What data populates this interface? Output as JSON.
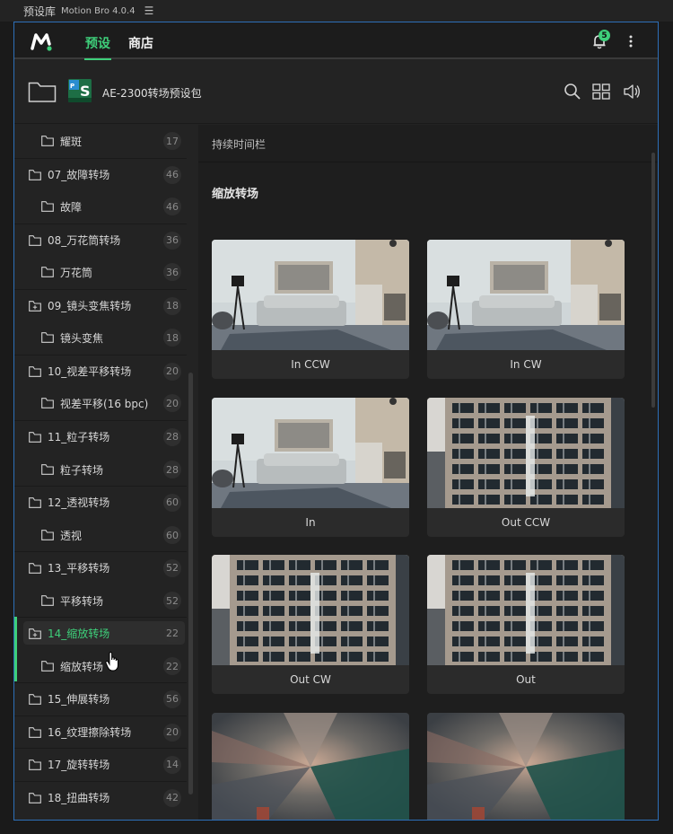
{
  "window": {
    "title": "预设库",
    "app_version": "Motion Bro 4.0.4",
    "menu_icon": "hamburger-icon"
  },
  "topnav": {
    "tabs": [
      {
        "label": "预设",
        "active": true
      },
      {
        "label": "商店",
        "active": false
      }
    ],
    "notification_count": "5",
    "accent_color": "#3ecf7a"
  },
  "pack": {
    "title": "AE-2300转场预设包",
    "icons": [
      "folder-icon",
      "search-icon",
      "grid-view-icon",
      "volume-icon"
    ]
  },
  "sidebar": {
    "items": [
      {
        "label": "耀斑",
        "count": "17",
        "level": "child",
        "icon": "folder-icon"
      },
      {
        "label": "07_故障转场",
        "count": "46",
        "level": "parent",
        "icon": "folder-icon"
      },
      {
        "label": "故障",
        "count": "46",
        "level": "child",
        "icon": "folder-icon"
      },
      {
        "label": "08_万花筒转场",
        "count": "36",
        "level": "parent",
        "icon": "folder-icon"
      },
      {
        "label": "万花筒",
        "count": "36",
        "level": "child",
        "icon": "folder-icon"
      },
      {
        "label": "09_镜头变焦转场",
        "count": "18",
        "level": "parent",
        "icon": "zoom-folder-icon"
      },
      {
        "label": "镜头变焦",
        "count": "18",
        "level": "child",
        "icon": "folder-icon"
      },
      {
        "label": "10_视差平移转场",
        "count": "20",
        "level": "parent",
        "icon": "folder-icon"
      },
      {
        "label": "视差平移(16 bpc)",
        "count": "20",
        "level": "child",
        "icon": "folder-icon"
      },
      {
        "label": "11_粒子转场",
        "count": "28",
        "level": "parent",
        "icon": "folder-icon"
      },
      {
        "label": "粒子转场",
        "count": "28",
        "level": "child",
        "icon": "folder-icon"
      },
      {
        "label": "12_透视转场",
        "count": "60",
        "level": "parent",
        "icon": "folder-icon"
      },
      {
        "label": "透视",
        "count": "60",
        "level": "child",
        "icon": "folder-icon"
      },
      {
        "label": "13_平移转场",
        "count": "52",
        "level": "parent",
        "icon": "folder-icon"
      },
      {
        "label": "平移转场",
        "count": "52",
        "level": "child",
        "icon": "folder-icon"
      },
      {
        "label": "14_缩放转场",
        "count": "22",
        "level": "parent",
        "icon": "zoom-folder-icon",
        "selected": true
      },
      {
        "label": "缩放转场",
        "count": "22",
        "level": "child",
        "icon": "folder-icon"
      },
      {
        "label": "15_伸展转场",
        "count": "56",
        "level": "parent",
        "icon": "folder-icon"
      },
      {
        "label": "16_纹理擦除转场",
        "count": "20",
        "level": "parent",
        "icon": "folder-icon"
      },
      {
        "label": "17_旋转转场",
        "count": "14",
        "level": "parent",
        "icon": "folder-icon"
      },
      {
        "label": "18_扭曲转场",
        "count": "42",
        "level": "parent",
        "icon": "folder-icon"
      }
    ]
  },
  "content": {
    "duration_bar": "持续时间栏",
    "section_title": "缩放转场",
    "cards": [
      {
        "label": "In CCW",
        "thumb": "living-room"
      },
      {
        "label": "In CW",
        "thumb": "living-room"
      },
      {
        "label": "In",
        "thumb": "living-room"
      },
      {
        "label": "Out CCW",
        "thumb": "building"
      },
      {
        "label": "Out CW",
        "thumb": "building"
      },
      {
        "label": "Out",
        "thumb": "building"
      },
      {
        "label": "In CCW",
        "thumb": "motion-blur"
      },
      {
        "label": "In CW",
        "thumb": "motion-blur"
      }
    ]
  }
}
